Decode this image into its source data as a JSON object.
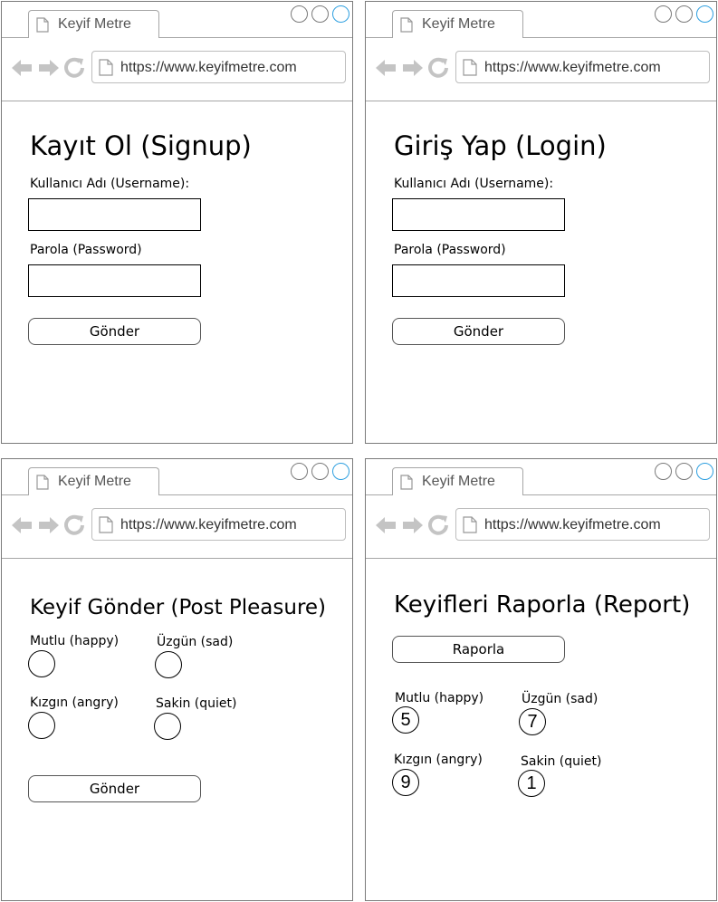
{
  "browser": {
    "tab_title": "Keyif Metre",
    "url": "https://www.keyifmetre.com"
  },
  "signup": {
    "title": "Kayıt Ol (Signup)",
    "username_label": "Kullanıcı Adı (Username):",
    "password_label": "Parola (Password)",
    "submit_label": "Gönder"
  },
  "login": {
    "title": "Giriş Yap (Login)",
    "username_label": "Kullanıcı Adı (Username):",
    "password_label": "Parola (Password)",
    "submit_label": "Gönder"
  },
  "post": {
    "title": "Keyif Gönder (Post Pleasure)",
    "options": {
      "happy": "Mutlu (happy)",
      "sad": "Üzgün (sad)",
      "angry": "Kızgın (angry)",
      "quiet": "Sakin (quiet)"
    },
    "submit_label": "Gönder"
  },
  "report": {
    "title": "Keyifleri Raporla (Report)",
    "button_label": "Raporla",
    "items": {
      "happy": {
        "label": "Mutlu (happy)",
        "count": "5"
      },
      "sad": {
        "label": "Üzgün (sad)",
        "count": "7"
      },
      "angry": {
        "label": "Kızgın (angry)",
        "count": "9"
      },
      "quiet": {
        "label": "Sakin (quiet)",
        "count": "1"
      }
    }
  },
  "icons": [
    "page-icon",
    "back-arrow-icon",
    "forward-arrow-icon",
    "reload-icon",
    "window-control-icon",
    "maximize-icon"
  ]
}
